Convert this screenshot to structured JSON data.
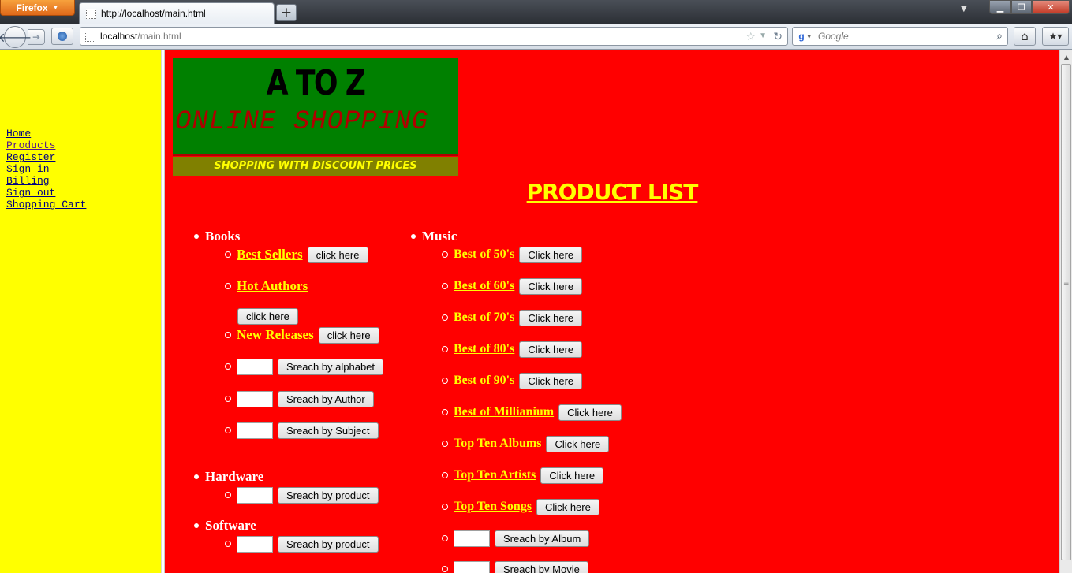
{
  "browser": {
    "app_button": "Firefox",
    "tab_title": "http://localhost/main.html",
    "new_tab": "+",
    "url_host": "localhost",
    "url_path": "/main.html",
    "search_placeholder": "Google",
    "search_engine": "g"
  },
  "sidebar": {
    "items": [
      {
        "label": "Home"
      },
      {
        "label": "Products"
      },
      {
        "label": "Register"
      },
      {
        "label": "Sign in"
      },
      {
        "label": "Billing"
      },
      {
        "label": "Sign out"
      },
      {
        "label": "Shopping Cart"
      }
    ]
  },
  "banner": {
    "title": "A TO Z",
    "subtitle": "ONLINE SHOPPING",
    "tagline": "SHOPPING WITH DISCOUNT PRICES"
  },
  "main": {
    "title": "PRODUCT LIST",
    "books": {
      "label": "Books",
      "best_sellers": "Best Sellers",
      "hot_authors": "Hot Authors",
      "new_releases": "New Releases",
      "click_here": "click here",
      "search_alphabet": "Sreach by alphabet",
      "search_author": "Sreach by Author",
      "search_subject": "Sreach by Subject"
    },
    "hardware": {
      "label": "Hardware",
      "search_product": "Sreach by product"
    },
    "software": {
      "label": "Software",
      "search_product": "Sreach by product"
    },
    "music": {
      "label": "Music",
      "click_here": "Click here",
      "items": [
        "Best of 50's",
        "Best of 60's",
        "Best of 70's",
        "Best of 80's",
        "Best of 90's",
        "Best of Millianium",
        "Top Ten Albums",
        "Top Ten Artists",
        "Top Ten Songs"
      ],
      "search_album": "Sreach by Album",
      "search_movie": "Sreach by Movie"
    }
  },
  "colors": {
    "main_bg": "#ff0000",
    "sidebar_bg": "#ffff00",
    "banner_bg": "#008000",
    "tagline_bg": "#808000",
    "link": "#ffff00"
  }
}
